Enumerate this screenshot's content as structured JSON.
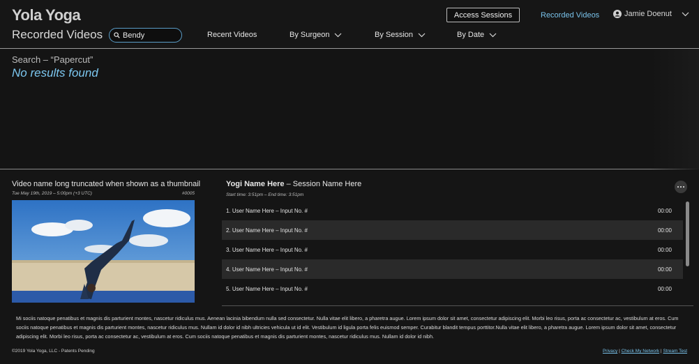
{
  "header": {
    "logo": "Yola Yoga",
    "page_title": "Recorded Videos",
    "search_value": "Bendy",
    "nav": [
      "Recent Videos",
      "By Surgeon",
      "By Session",
      "By Date"
    ],
    "access_button": "Access Sessions",
    "recorded_link": "Recorded Videos",
    "user_name": "Jamie Doenut"
  },
  "results": {
    "query": "Search – “Papercut”",
    "message": "No results found"
  },
  "video": {
    "title": "Video name long truncated when shown as a thumbnail",
    "date": "Tue May 19th, 2019 – 5:00pm (+3 UTC)",
    "id": "#0005"
  },
  "session": {
    "yogi": "Yogi Name Here",
    "separator": " – ",
    "name": "Session Name Here",
    "times": "Start time: 3:51pm  –  End time: 3:51pm",
    "rows": [
      {
        "label": "1.  User Name Here – Input No. #",
        "time": "00:00"
      },
      {
        "label": "2.  User Name Here – Input No. #",
        "time": "00:00"
      },
      {
        "label": "3.  User Name Here – Input No. #",
        "time": "00:00"
      },
      {
        "label": "4.  User Name Here – Input No. #",
        "time": "00:00"
      },
      {
        "label": "5.  User Name Here – Input No. #",
        "time": "00:00"
      }
    ]
  },
  "footer": {
    "text": "Mi sociis natoque penatibus et magnis dis parturient montes, nascetur ridiculus mus. Aenean lacinia bibendum nulla sed consectetur. Nulla vitae elit libero, a pharetra augue. Lorem ipsum dolor sit amet, consectetur adipiscing elit. Morbi leo risus, porta ac consectetur ac, vestibulum at eros. Cum sociis natoque penatibus et magnis dis parturient montes, nascetur ridiculus mus. Nullam id dolor id nibh ultricies vehicula ut id elit. Vestibulum id ligula porta felis euismod semper. Curabitur blandit tempus porttitor.Nulla vitae elit libero, a pharetra augue. Lorem ipsum dolor sit amet, consectetur adipiscing elit. Morbi leo risus, porta ac consectetur ac, vestibulum at eros. Cum sociis natoque penatibus et magnis dis parturient montes, nascetur ridiculus mus. Nullam id dolor id nibh.",
    "copyright": "©2019 Yola Yoga, LLC - Patents Pending",
    "links": [
      "Privacy",
      "Check My Network",
      "Stream Test"
    ]
  },
  "colors": {
    "accent": "#79c2ea",
    "background": "#151515",
    "row_alt": "#2a2a2a"
  },
  "icons": [
    "search-icon",
    "chevron-down-icon",
    "user-icon",
    "more-icon"
  ]
}
